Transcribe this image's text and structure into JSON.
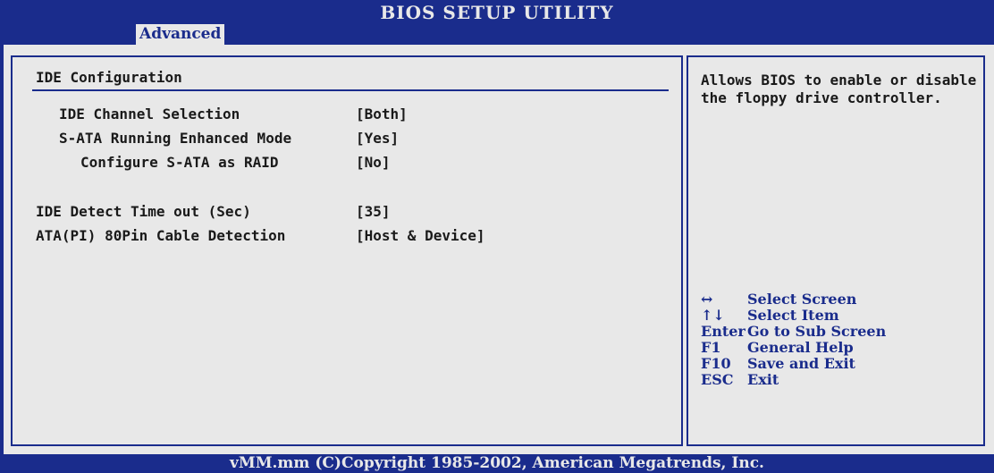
{
  "header": {
    "title": "BIOS SETUP UTILITY",
    "active_tab": "Advanced"
  },
  "main": {
    "section_title": "IDE Configuration",
    "items": [
      {
        "label": "IDE Channel Selection",
        "value": "[Both]"
      },
      {
        "label": "S-ATA Running Enhanced Mode",
        "value": "[Yes]"
      },
      {
        "label": "Configure S-ATA as RAID",
        "value": "[No]"
      },
      {
        "label": "IDE Detect Time out (Sec)",
        "value": "[35]"
      },
      {
        "label": "ATA(PI) 80Pin Cable Detection",
        "value": "[Host & Device]"
      }
    ]
  },
  "help": {
    "text": "Allows BIOS to enable or disable the floppy drive controller.",
    "keys": [
      {
        "key": "↔",
        "desc": "Select Screen"
      },
      {
        "key": "↑↓",
        "desc": "Select Item"
      },
      {
        "key": "Enter",
        "desc": "Go to Sub Screen"
      },
      {
        "key": "F1",
        "desc": "General Help"
      },
      {
        "key": "F10",
        "desc": "Save and Exit"
      },
      {
        "key": "ESC",
        "desc": "Exit"
      }
    ]
  },
  "footer": {
    "text": "vMM.mm (C)Copyright 1985-2002, American Megatrends, Inc."
  },
  "colors": {
    "bios_blue": "#1a2c8c",
    "bios_gray": "#e8e8e8",
    "text": "#1a1a1a"
  }
}
